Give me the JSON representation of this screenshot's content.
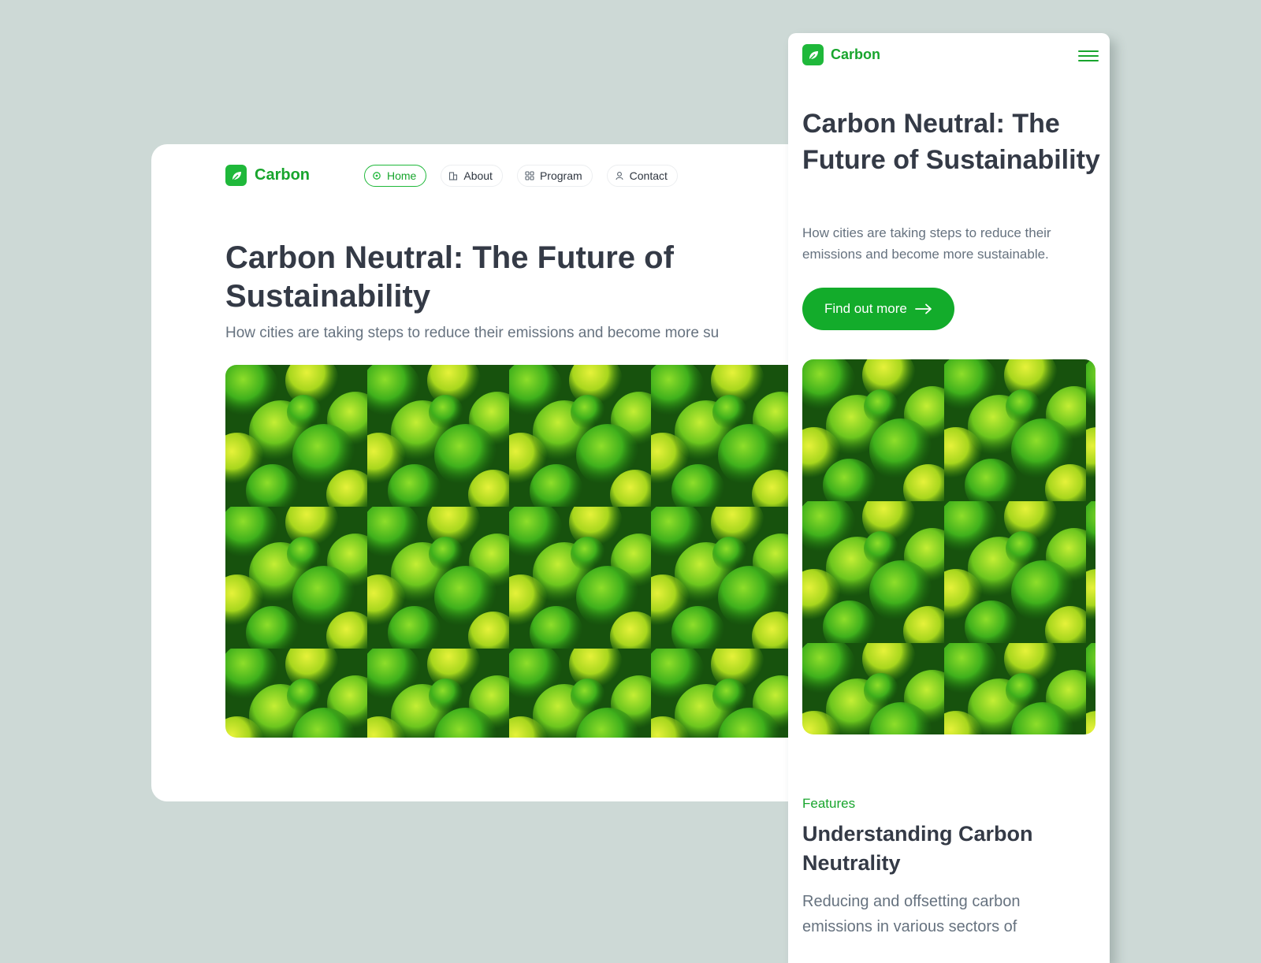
{
  "brand": {
    "name": "Carbon",
    "accent": "#1fb83a"
  },
  "desktop": {
    "nav": [
      {
        "label": "Home",
        "icon": "home-icon",
        "active": true
      },
      {
        "label": "About",
        "icon": "building-icon",
        "active": false
      },
      {
        "label": "Program",
        "icon": "grid-icon",
        "active": false
      },
      {
        "label": "Contact",
        "icon": "contact-icon",
        "active": false
      }
    ],
    "title": "Carbon Neutral: The Future of Sustainability",
    "subtitle": "How cities are taking steps to reduce their emissions and become more su"
  },
  "mobile": {
    "title": "Carbon Neutral: The Future of Sustainability",
    "subtitle": "How cities are taking steps to reduce their emissions and become more sustainable.",
    "cta_label": "Find out more",
    "features": {
      "eyebrow": "Features",
      "heading": "Understanding Carbon Neutrality",
      "body": "Reducing and offsetting carbon emissions in various sectors of"
    }
  }
}
